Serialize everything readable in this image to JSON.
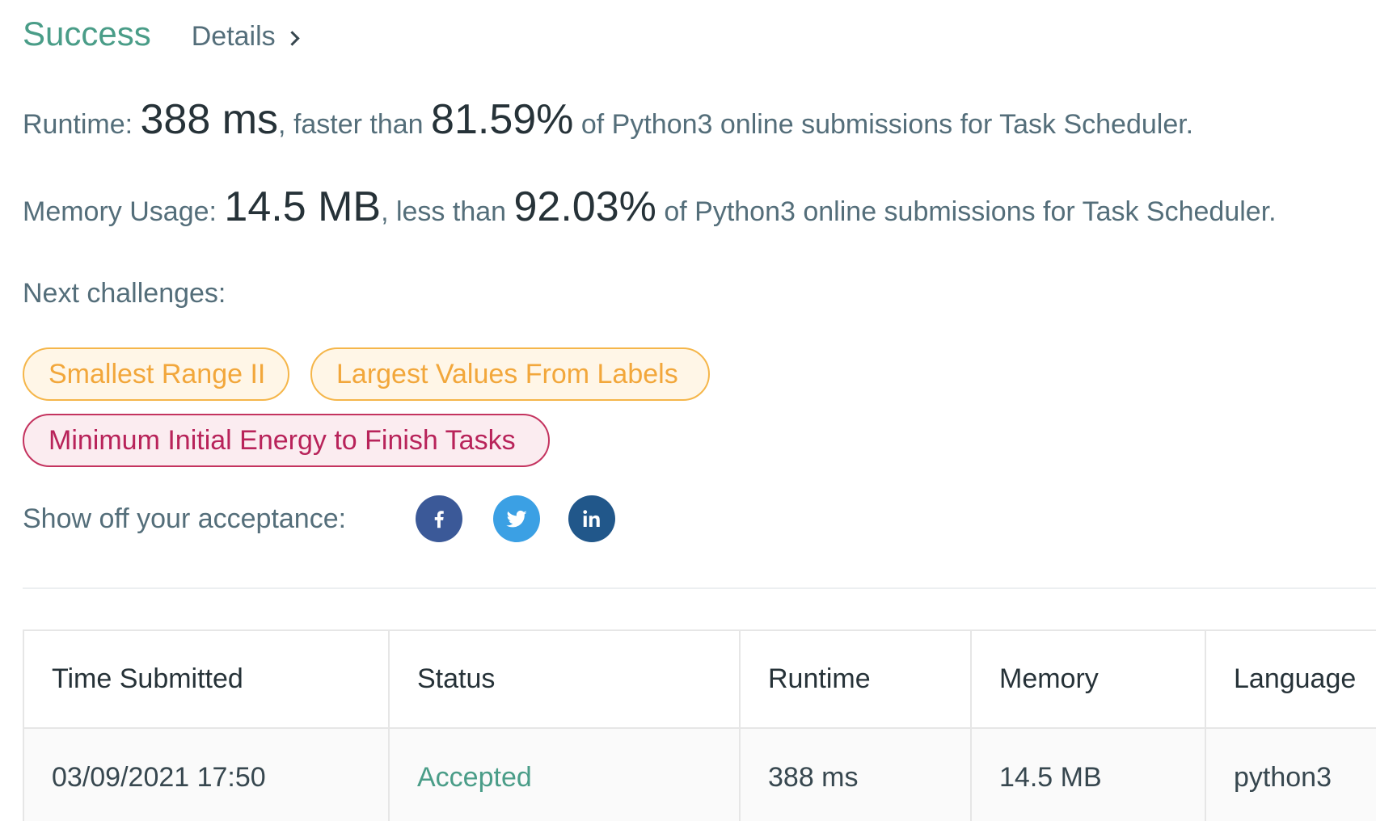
{
  "header": {
    "status_label": "Success",
    "details_label": "Details"
  },
  "runtime_stat": {
    "label": "Runtime:",
    "value": "388 ms",
    "comparison": ", faster than",
    "percent": "81.59%",
    "suffix": "of Python3 online submissions for Task Scheduler."
  },
  "memory_stat": {
    "label": "Memory Usage:",
    "value": "14.5 MB",
    "comparison": ", less than",
    "percent": "92.03%",
    "suffix": "of Python3 online submissions for Task Scheduler."
  },
  "next_challenges": {
    "label": "Next challenges:",
    "items": [
      {
        "title": "Smallest Range II",
        "difficulty": "medium"
      },
      {
        "title": "Largest Values From Labels",
        "difficulty": "medium"
      },
      {
        "title": "Minimum Initial Energy to Finish Tasks",
        "difficulty": "hard"
      }
    ]
  },
  "share": {
    "label": "Show off your acceptance:",
    "icons": [
      "facebook-icon",
      "twitter-icon",
      "linkedin-icon"
    ]
  },
  "colors": {
    "success": "#4a9d88",
    "medium": "#f2a73b",
    "hard": "#b8235a",
    "facebook": "#3b5998",
    "twitter": "#3ba0e4",
    "linkedin": "#21578a"
  },
  "submissions_table": {
    "headers": [
      "Time Submitted",
      "Status",
      "Runtime",
      "Memory",
      "Language"
    ],
    "rows": [
      {
        "time": "03/09/2021 17:50",
        "status": "Accepted",
        "runtime": "388 ms",
        "memory": "14.5 MB",
        "language": "python3"
      }
    ]
  }
}
